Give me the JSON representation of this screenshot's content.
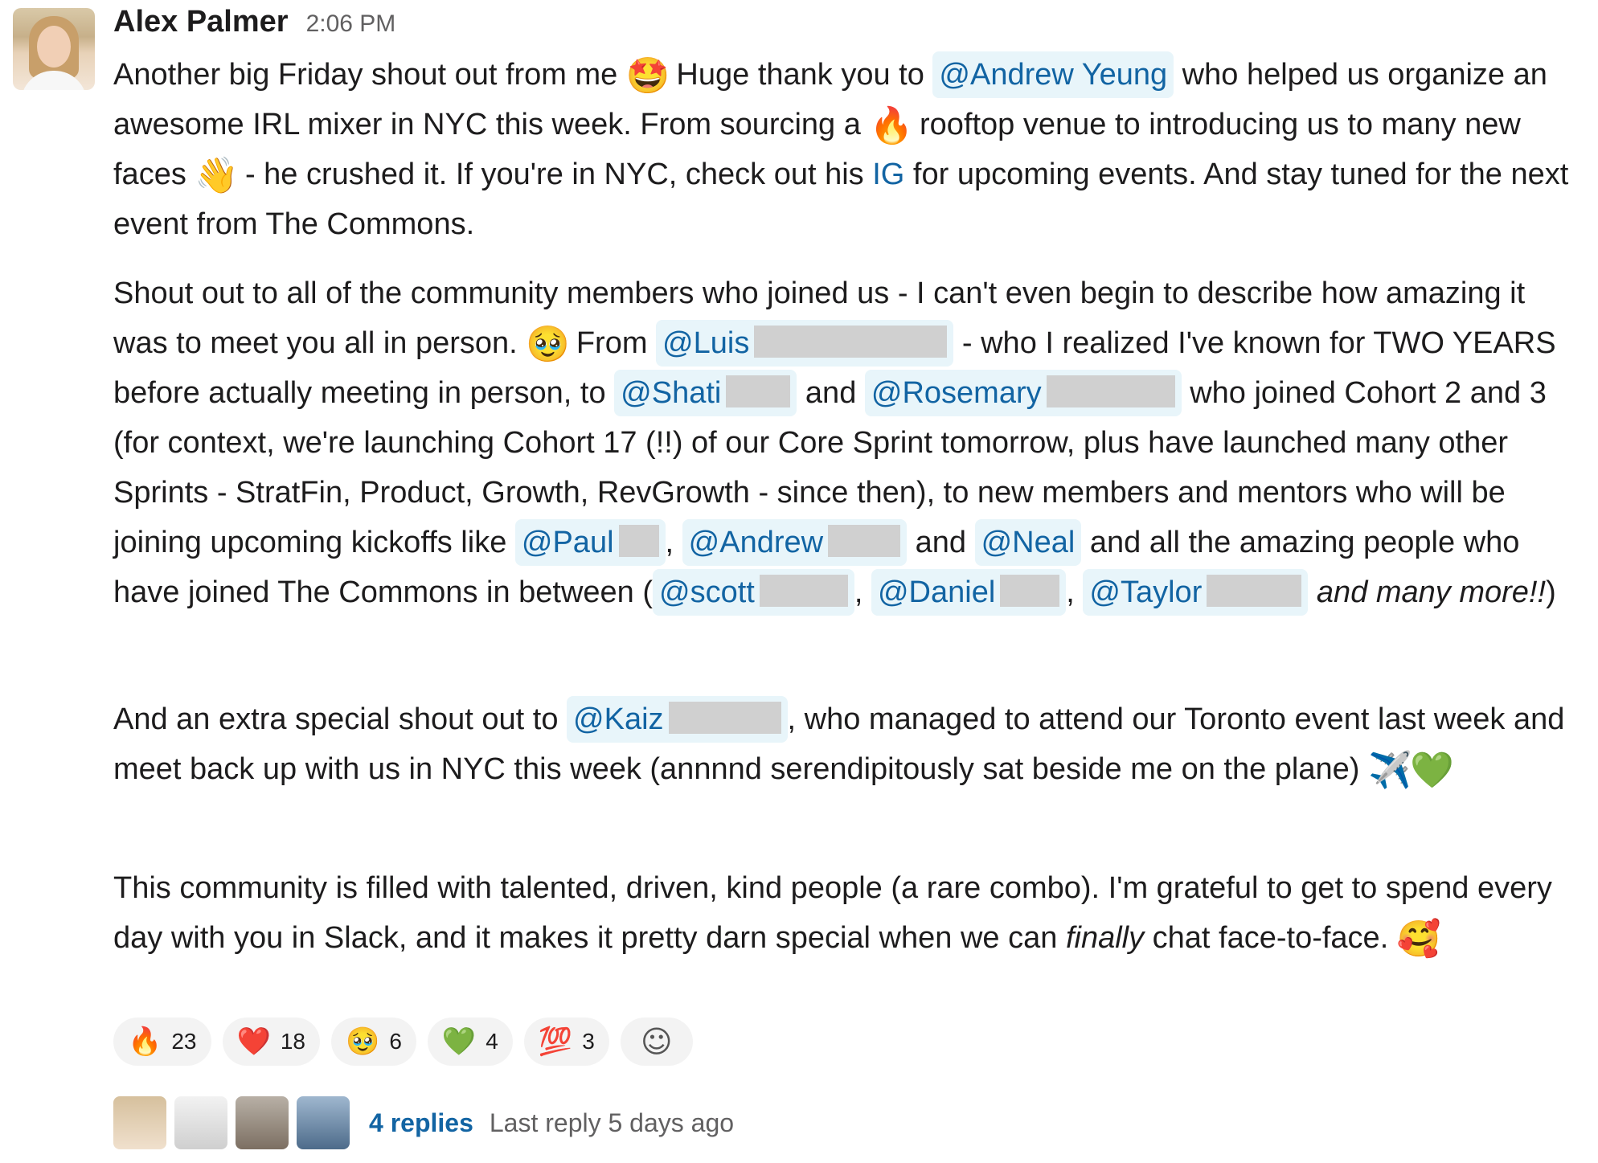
{
  "message": {
    "sender": "Alex Palmer",
    "timestamp": "2:06 PM",
    "p1": {
      "t1": "Another big Friday shout out from me",
      "e1": "🤩",
      "t2": "Huge thank you to",
      "m1": "@Andrew Yeung",
      "t3": "who helped us organize an awesome IRL mixer in NYC this week. From sourcing a",
      "e2": "🔥",
      "t4": "rooftop venue to introducing us to many new faces",
      "e3": "👋",
      "t5": "- he crushed it. If you're in NYC, check out his",
      "link": "IG",
      "t6": "for upcoming events. And stay tuned for the next event from The Commons."
    },
    "p2": {
      "t1": "Shout out to all of the community members who joined us - I can't even begin to describe how amazing it was to meet you all in person.",
      "e1": "🥹",
      "t2": "From",
      "m1": "@Luis",
      "t3": "- who I realized I've known for TWO YEARS before actually meeting in person, to",
      "m2": "@Shati",
      "t4": "and",
      "m3": "@Rosemary",
      "t5": "who joined Cohort 2 and 3 (for context, we're launching Cohort 17 (!!) of our Core Sprint tomorrow, plus have launched many other Sprints - StratFin, Product, Growth, RevGrowth - since then), to new members and mentors who will be joining upcoming kickoffs like",
      "m4": "@Paul",
      "sep1": ",",
      "m5": "@Andrew",
      "t6": "and",
      "m6": "@Neal",
      "t7": "and all the amazing people who have joined The Commons in between (",
      "m7": "@scott",
      "sep2": ",",
      "m8": "@Daniel",
      "sep3": ",",
      "m9": "@Taylor",
      "italic": "and many more!!",
      "close": ")"
    },
    "p3": {
      "t1": "And an extra special shout out to",
      "m1": "@Kaiz",
      "t2": ", who managed to attend our Toronto event last week and meet back up with us in NYC this week (annnnd serendipitously sat beside me on the plane)",
      "e1": "✈️",
      "e2": "💚"
    },
    "p4": {
      "t1": "This community is filled with talented, driven, kind people (a rare combo). I'm grateful to get to spend every day with you in Slack, and it makes it pretty darn special when we can",
      "italic": "finally",
      "t2": "chat face-to-face.",
      "e1": "🥰"
    }
  },
  "reactions": [
    {
      "emoji": "🔥",
      "count": "23"
    },
    {
      "emoji": "❤️",
      "count": "18"
    },
    {
      "emoji": "🥹",
      "count": "6"
    },
    {
      "emoji": "💚",
      "count": "4"
    },
    {
      "emoji": "💯",
      "count": "3"
    }
  ],
  "add_reaction_icon": "☺",
  "thread": {
    "replies": "4 replies",
    "last_reply": "Last reply 5 days ago"
  }
}
